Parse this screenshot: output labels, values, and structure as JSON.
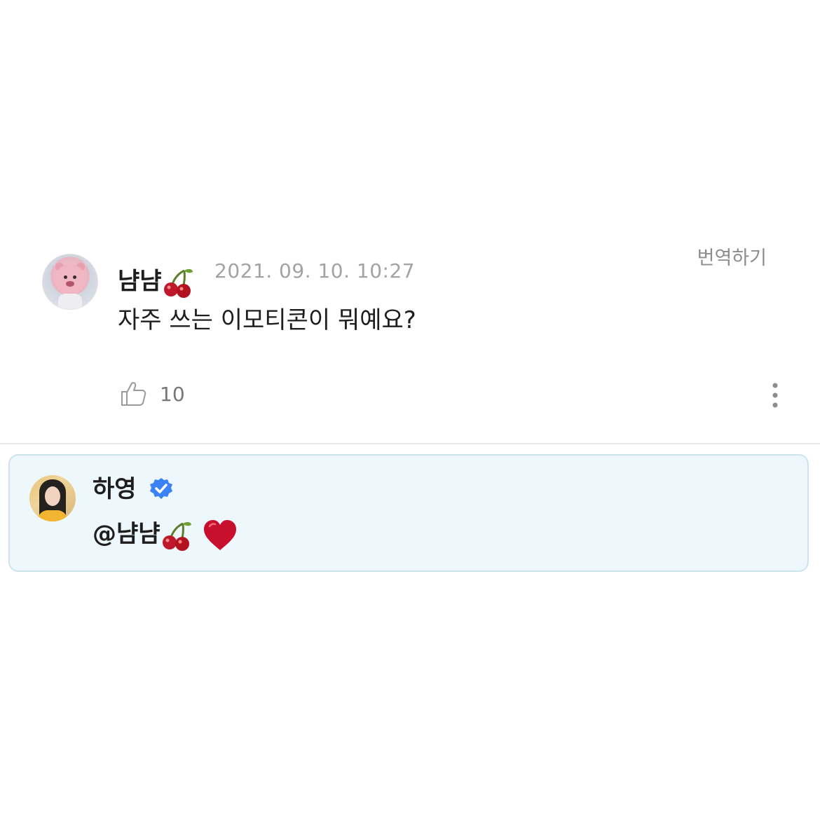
{
  "comment": {
    "username": "냠냠",
    "username_emoji": "cherry",
    "timestamp": "2021. 09. 10. 10:27",
    "translate_label": "번역하기",
    "text": "자주 쓰는 이모티콘이 뭐예요?",
    "like_count": "10",
    "avatar": "loopy-avatar"
  },
  "reply": {
    "username": "하영",
    "verified_icon": "verified-check-icon",
    "mention": "@냠냠",
    "mention_emoji": "cherry",
    "reaction_emoji": "red-heart",
    "avatar": "profile-photo-avatar"
  },
  "colors": {
    "reply_bg": "#eef8fc",
    "reply_border": "#cfe3ea",
    "verified_blue": "#3b82f6",
    "heart_red": "#c8102e",
    "muted_text": "#a3a3a3"
  }
}
